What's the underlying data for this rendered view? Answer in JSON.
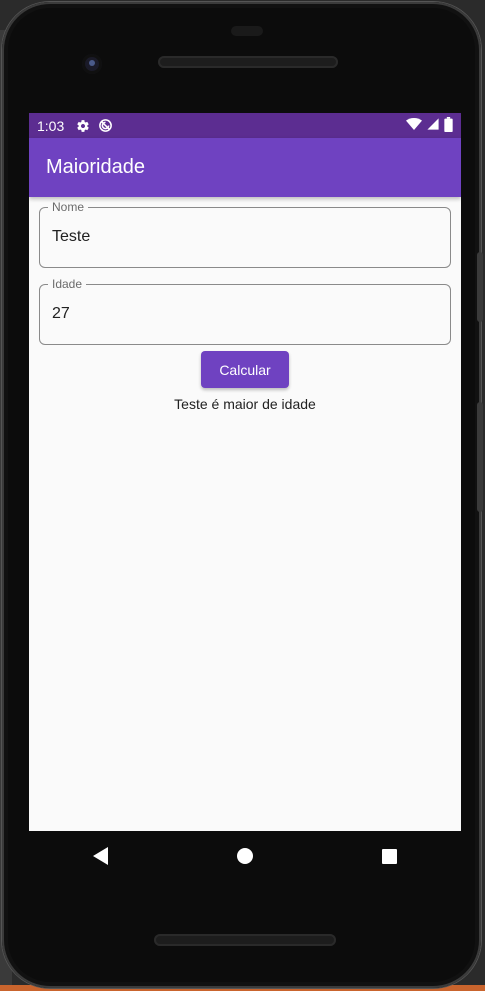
{
  "status_bar": {
    "time": "1:03",
    "icons": [
      "settings-icon",
      "sync-disabled-icon"
    ],
    "right_icons": [
      "wifi-icon",
      "cellular-signal-icon",
      "battery-icon"
    ]
  },
  "app_bar": {
    "title": "Maioridade"
  },
  "form": {
    "nome": {
      "label": "Nome",
      "value": "Teste"
    },
    "idade": {
      "label": "Idade",
      "value": "27"
    },
    "button_label": "Calcular",
    "result_text": "Teste é maior de idade"
  },
  "nav_bar": {
    "buttons": [
      "back-icon",
      "home-icon",
      "recents-icon"
    ]
  },
  "colors": {
    "primary": "#6f42c1",
    "primary_dark": "#5c2d91",
    "background": "#fafafa"
  }
}
